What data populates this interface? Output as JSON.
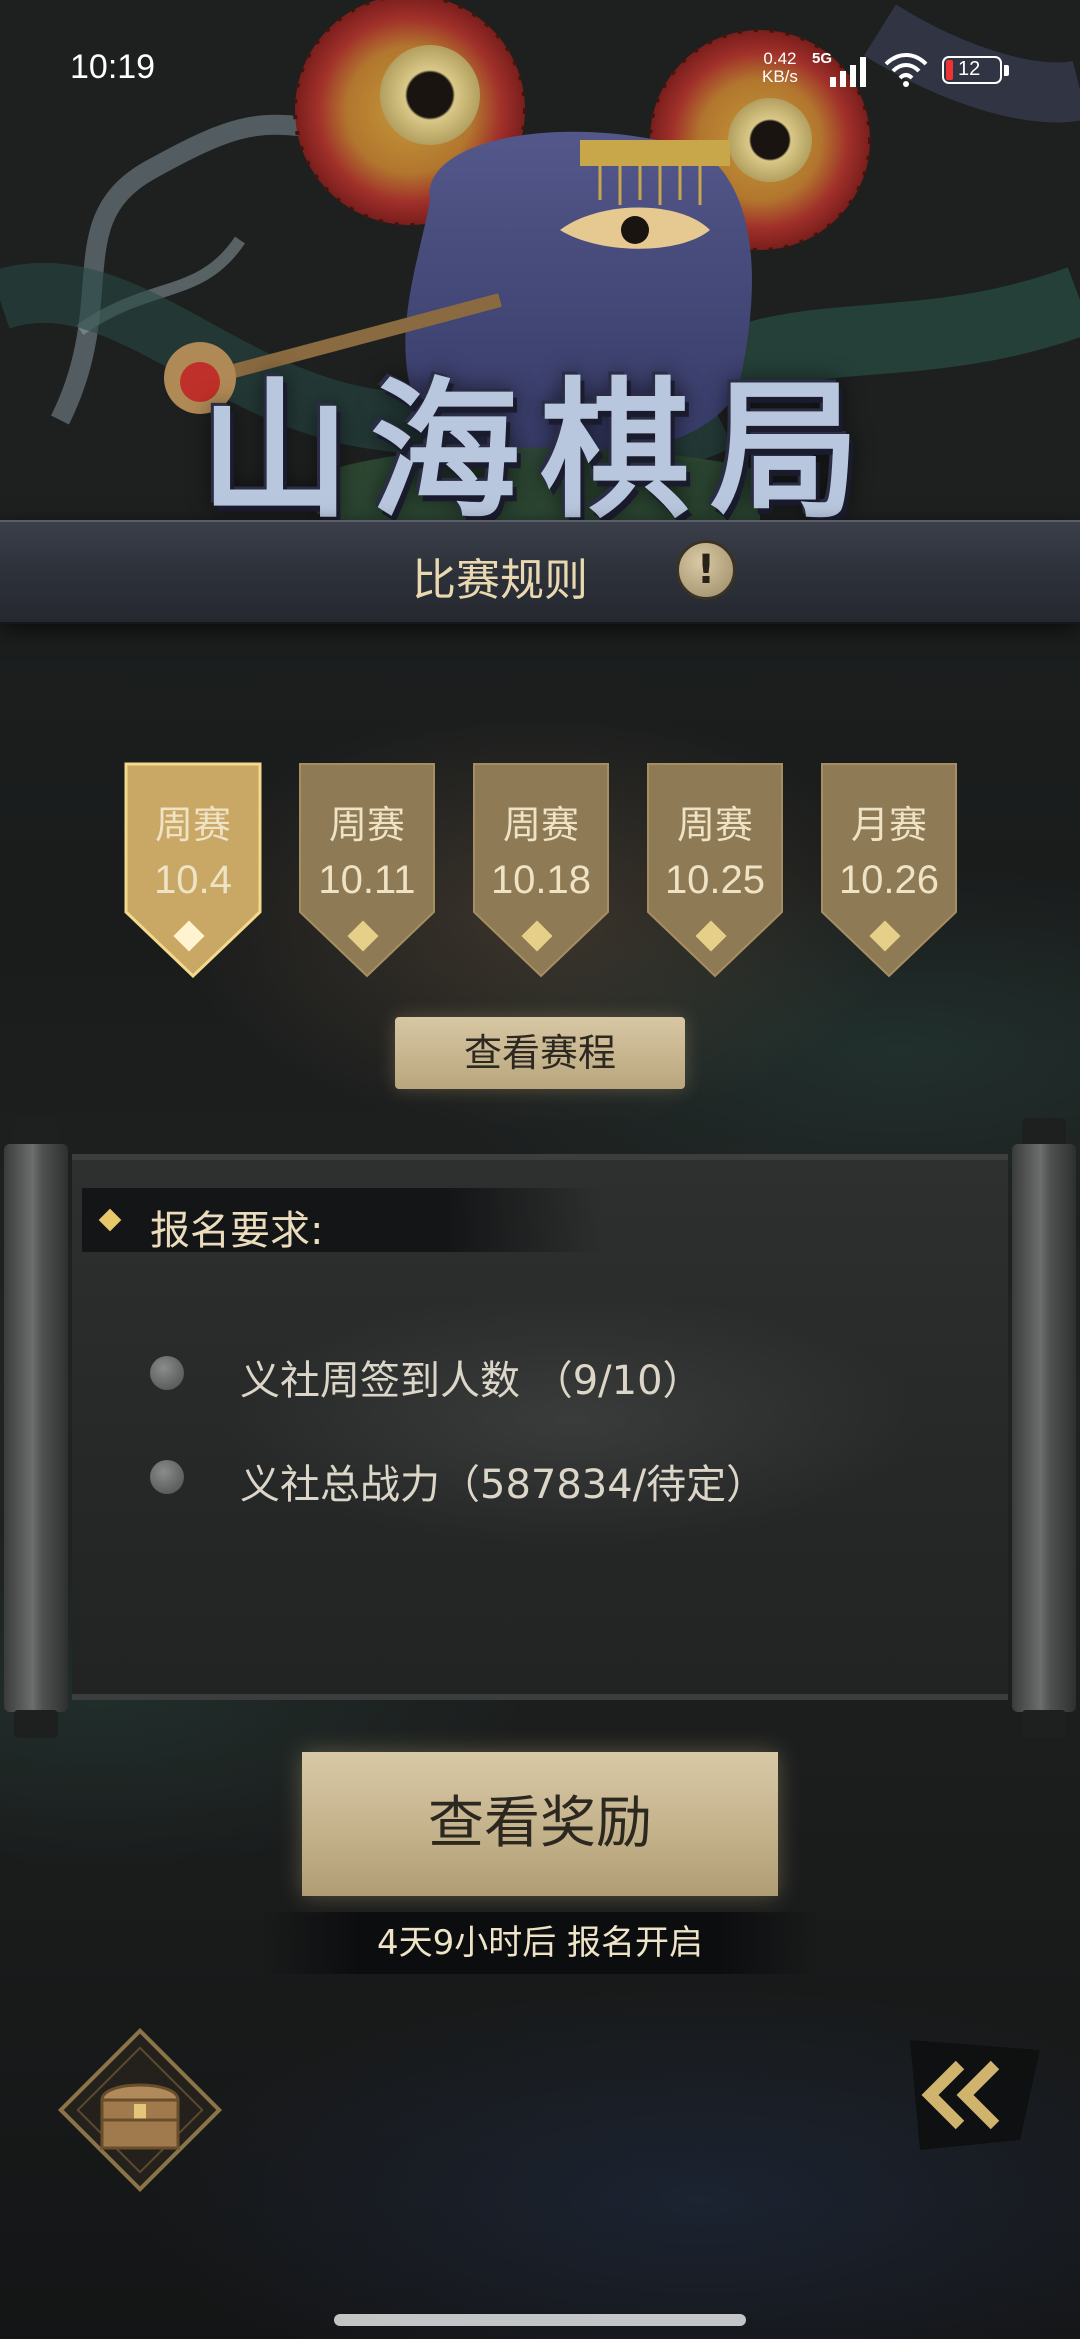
{
  "status_bar": {
    "time": "10:19",
    "net_speed_value": "0.42",
    "net_speed_unit": "KB/s",
    "network": "5G",
    "battery": "12",
    "battery_color": "#e33333"
  },
  "header": {
    "title": "山海棋局",
    "rules_label": "比赛规则",
    "rules_icon": "!"
  },
  "tabs": [
    {
      "type": "周赛",
      "date": "10.4",
      "selected": true
    },
    {
      "type": "周赛",
      "date": "10.11",
      "selected": false
    },
    {
      "type": "周赛",
      "date": "10.18",
      "selected": false
    },
    {
      "type": "周赛",
      "date": "10.25",
      "selected": false
    },
    {
      "type": "月赛",
      "date": "10.26",
      "selected": false
    }
  ],
  "schedule_button": "查看赛程",
  "requirements": {
    "title": "报名要求:",
    "items": [
      {
        "text": "义社周签到人数 （9/10）"
      },
      {
        "text": "义社总战力（587834/待定）"
      }
    ]
  },
  "reward_button": "查看奖励",
  "signup_status": "4天9小时后 报名开启",
  "icons": {
    "chest": "treasure-chest-icon",
    "back": "double-chevron-left-icon"
  },
  "colors": {
    "accent_gold": "#e8c66a",
    "tab_selected": "#c9a764",
    "tab_normal": "#8e7a55"
  }
}
